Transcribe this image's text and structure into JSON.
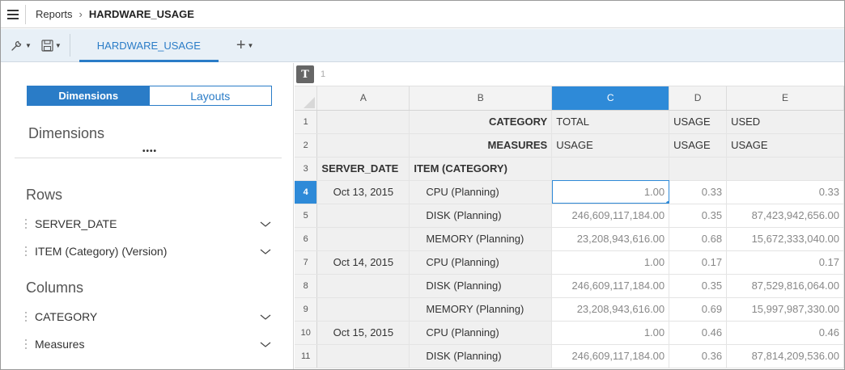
{
  "breadcrumb": {
    "root": "Reports",
    "current": "HARDWARE_USAGE"
  },
  "toolbar": {
    "tab_label": "HARDWARE_USAGE",
    "add_tab": "+"
  },
  "panel": {
    "segment": {
      "dimensions": "Dimensions",
      "layouts": "Layouts",
      "active": "Dimensions"
    },
    "title": "Dimensions",
    "rows_title": "Rows",
    "rows": [
      "SERVER_DATE",
      "ITEM (Category) (Version)"
    ],
    "columns_title": "Columns",
    "columns": [
      "CATEGORY",
      "Measures"
    ]
  },
  "formula_bar": {
    "icon": "T",
    "cell_ref": "1"
  },
  "grid": {
    "col_headers": [
      "A",
      "B",
      "C",
      "D",
      "E"
    ],
    "selected_col": "C",
    "selected_row": 4,
    "row_numbers": [
      "1",
      "2",
      "3",
      "4",
      "5",
      "6",
      "7",
      "8",
      "9",
      "10",
      "11"
    ],
    "r1": {
      "b": "CATEGORY",
      "c": "TOTAL",
      "d": "USAGE",
      "e": "USED"
    },
    "r2": {
      "b": "MEASURES",
      "c": "USAGE",
      "d": "USAGE",
      "e": "USAGE"
    },
    "r3": {
      "a": "SERVER_DATE",
      "b": "ITEM (CATEGORY)"
    },
    "data": [
      {
        "date": "Oct 13, 2015",
        "item": "CPU (Planning)",
        "c": "1.00",
        "d": "0.33",
        "e": "0.33"
      },
      {
        "date": "",
        "item": "DISK (Planning)",
        "c": "246,609,117,184.00",
        "d": "0.35",
        "e": "87,423,942,656.00"
      },
      {
        "date": "",
        "item": "MEMORY (Planning)",
        "c": "23,208,943,616.00",
        "d": "0.68",
        "e": "15,672,333,040.00"
      },
      {
        "date": "Oct 14, 2015",
        "item": "CPU (Planning)",
        "c": "1.00",
        "d": "0.17",
        "e": "0.17"
      },
      {
        "date": "",
        "item": "DISK (Planning)",
        "c": "246,609,117,184.00",
        "d": "0.35",
        "e": "87,529,816,064.00"
      },
      {
        "date": "",
        "item": "MEMORY (Planning)",
        "c": "23,208,943,616.00",
        "d": "0.69",
        "e": "15,997,987,330.00"
      },
      {
        "date": "Oct 15, 2015",
        "item": "CPU (Planning)",
        "c": "1.00",
        "d": "0.46",
        "e": "0.46"
      },
      {
        "date": "",
        "item": "DISK (Planning)",
        "c": "246,609,117,184.00",
        "d": "0.36",
        "e": "87,814,209,536.00"
      }
    ]
  },
  "colors": {
    "accent": "#2a7cc7",
    "selection": "#2e8ad8",
    "toolbar_bg": "#e8f0f7"
  }
}
